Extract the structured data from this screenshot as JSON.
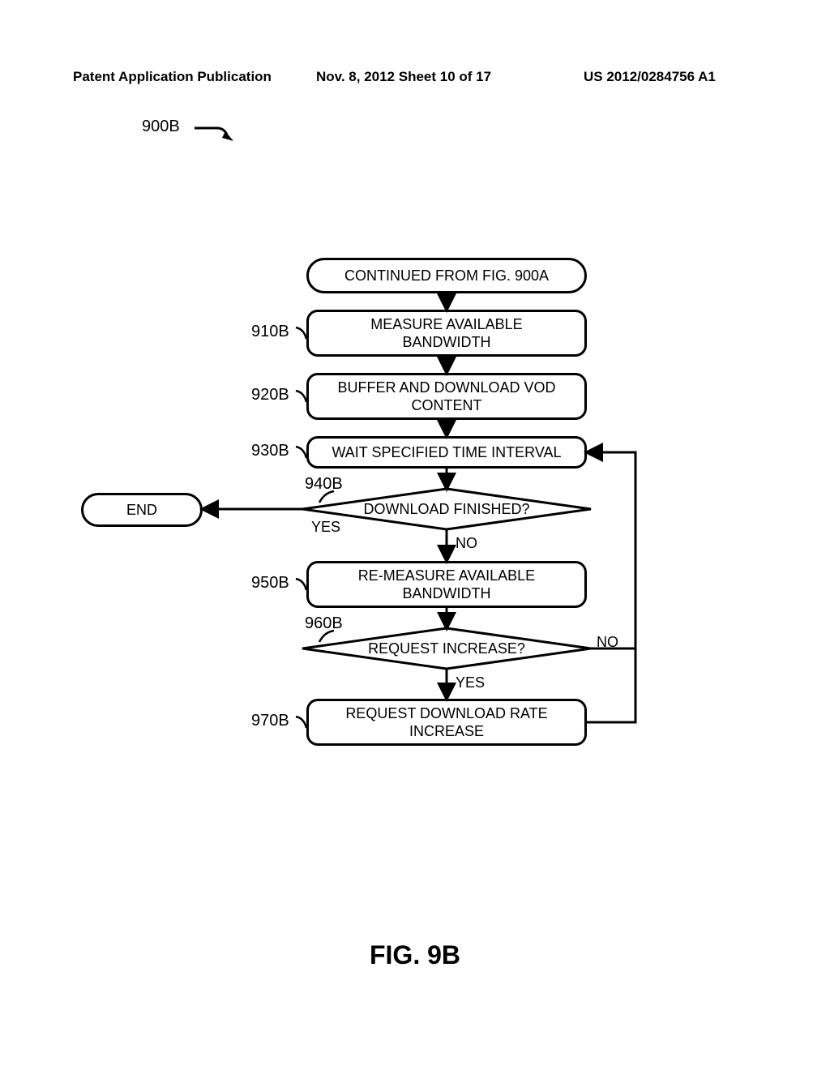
{
  "header": {
    "left": "Patent Application Publication",
    "center": "Nov. 8, 2012   Sheet 10 of 17",
    "right": "US 2012/0284756 A1"
  },
  "ref_number": "900B",
  "nodes": {
    "start": "CONTINUED FROM FIG. 900A",
    "n910": "MEASURE AVAILABLE\nBANDWIDTH",
    "n920": "BUFFER AND DOWNLOAD VOD\nCONTENT",
    "n930": "WAIT SPECIFIED TIME INTERVAL",
    "n940": "DOWNLOAD FINISHED?",
    "n950": "RE-MEASURE AVAILABLE\nBANDWIDTH",
    "n960": "REQUEST INCREASE?",
    "n970": "REQUEST DOWNLOAD RATE\nINCREASE",
    "end": "END"
  },
  "labels": {
    "l910": "910B",
    "l920": "920B",
    "l930": "930B",
    "l940": "940B",
    "l950": "950B",
    "l960": "960B",
    "l970": "970B"
  },
  "branch": {
    "yes940": "YES",
    "no940": "NO",
    "yes960": "YES",
    "no960": "NO"
  },
  "caption": "FIG. 9B"
}
